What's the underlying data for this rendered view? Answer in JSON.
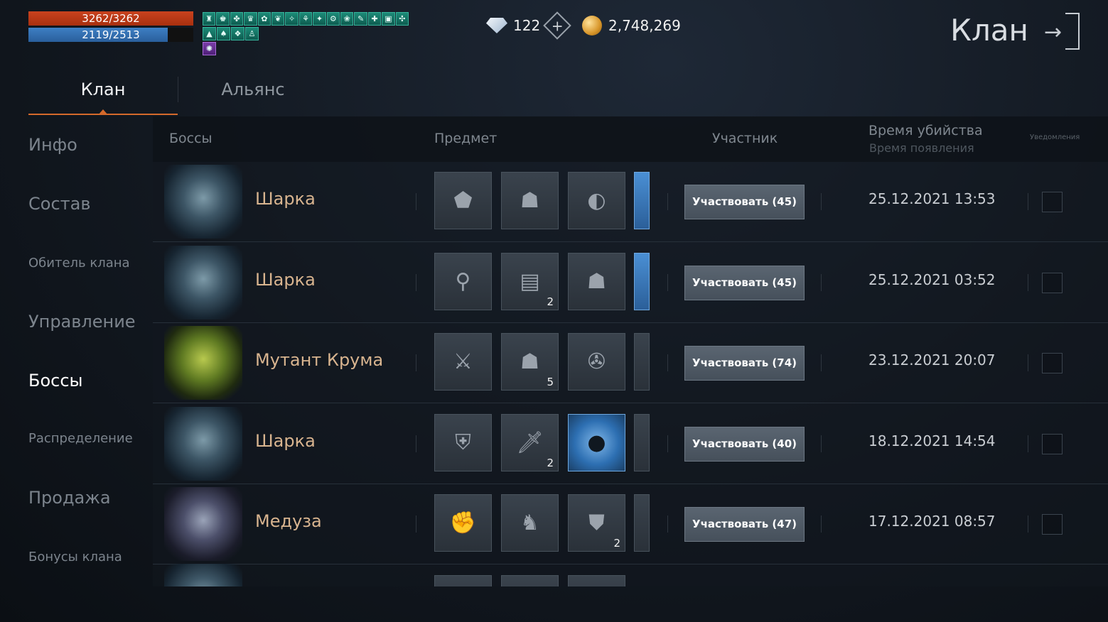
{
  "player": {
    "hp_text": "3262/3262",
    "mp_text": "2119/2513",
    "mp_ratio": 0.843
  },
  "buffs": {
    "row1": [
      "♜",
      "♚",
      "✤",
      "♛",
      "✿",
      "❦",
      "✧",
      "⚘",
      "✦",
      "⚙",
      "❀",
      "✎",
      "✚",
      "▣",
      "✣"
    ],
    "row2": [
      "▲",
      "♠",
      "❖",
      "♙"
    ],
    "row3": [
      "✺"
    ]
  },
  "currency": {
    "diamonds": "122",
    "plus": "+",
    "gold": "2,748,269"
  },
  "header": {
    "title": "Клан",
    "exit_arrow": "→"
  },
  "tabs": [
    {
      "label": "Клан",
      "active": true
    },
    {
      "label": "Альянс",
      "active": false
    }
  ],
  "sidebar": [
    {
      "label": "Инфо"
    },
    {
      "label": "Состав"
    },
    {
      "label": "Обитель клана"
    },
    {
      "label": "Управление"
    },
    {
      "label": "Боссы"
    },
    {
      "label": "Распределение"
    },
    {
      "label": "Продажа"
    },
    {
      "label": "Бонусы клана"
    }
  ],
  "table": {
    "col_bosses": "Боссы",
    "col_item": "Предмет",
    "col_member": "Участник",
    "col_kill_time": "Время убийства",
    "col_spawn_time": "Время появления",
    "col_notify": "Уведомления",
    "rows": [
      {
        "boss": "Шарка",
        "items": [
          {
            "icon": "⬟",
            "qty": ""
          },
          {
            "icon": "☗",
            "qty": ""
          },
          {
            "icon": "◐",
            "qty": ""
          }
        ],
        "join": "Участвовать (45)",
        "time": "25.12.2021 13:53"
      },
      {
        "boss": "Шарка",
        "items": [
          {
            "icon": "⚲",
            "qty": ""
          },
          {
            "icon": "▤",
            "qty": "2"
          },
          {
            "icon": "☗",
            "qty": ""
          }
        ],
        "join": "Участвовать (45)",
        "time": "25.12.2021 03:52"
      },
      {
        "boss": "Мутант Крума",
        "items": [
          {
            "icon": "⚔",
            "qty": ""
          },
          {
            "icon": "☗",
            "qty": "5"
          },
          {
            "icon": "✇",
            "qty": ""
          }
        ],
        "join": "Участвовать (74)",
        "time": "23.12.2021 20:07"
      },
      {
        "boss": "Шарка",
        "items": [
          {
            "icon": "⛨",
            "qty": ""
          },
          {
            "icon": "🗡",
            "qty": "2"
          },
          {
            "icon": "●",
            "qty": ""
          }
        ],
        "join": "Участвовать (40)",
        "time": "18.12.2021 14:54"
      },
      {
        "boss": "Медуза",
        "items": [
          {
            "icon": "✊",
            "qty": ""
          },
          {
            "icon": "♞",
            "qty": ""
          },
          {
            "icon": "⛊",
            "qty": "2"
          }
        ],
        "join": "Участвовать (47)",
        "time": "17.12.2021 08:57"
      }
    ]
  }
}
